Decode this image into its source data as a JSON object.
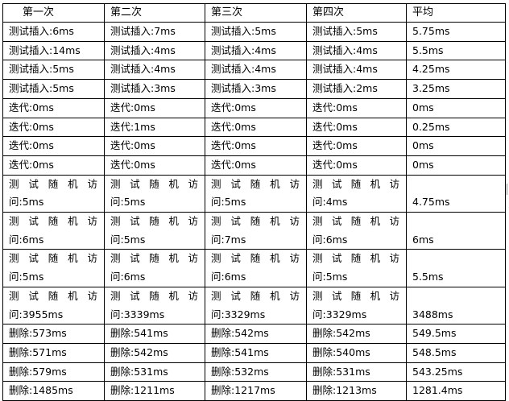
{
  "headers": [
    "第一次",
    "第二次",
    "第三次",
    "第四次",
    "平均"
  ],
  "rows": [
    {
      "cells": [
        "测试插入:6ms",
        "测试插入:7ms",
        "测试插入:5ms",
        "测试插入:5ms"
      ],
      "avg": "5.75ms"
    },
    {
      "cells": [
        "测试插入:14ms",
        "测试插入:4ms",
        "测试插入:4ms",
        "测试插入:4ms"
      ],
      "avg": "5.5ms"
    },
    {
      "cells": [
        "测试插入:5ms",
        "测试插入:4ms",
        "测试插入:4ms",
        "测试插入:4ms"
      ],
      "avg": "4.25ms"
    },
    {
      "cells": [
        "测试插入:5ms",
        "测试插入:3ms",
        "测试插入:3ms",
        "测试插入:2ms"
      ],
      "avg": "3.25ms"
    },
    {
      "cells": [
        "迭代:0ms",
        "迭代:0ms",
        "迭代:0ms",
        "迭代:0ms"
      ],
      "avg": "0ms"
    },
    {
      "cells": [
        "迭代:0ms",
        "迭代:1ms",
        "迭代:0ms",
        "迭代:0ms"
      ],
      "avg": "0.25ms"
    },
    {
      "cells": [
        "迭代:0ms",
        "迭代:0ms",
        "迭代:0ms",
        "迭代:0ms"
      ],
      "avg": "0ms"
    },
    {
      "cells": [
        "迭代:0ms",
        "迭代:0ms",
        "迭代:0ms",
        "迭代:0ms"
      ],
      "avg": "0ms"
    }
  ],
  "wrap_prefix": "测试随机访",
  "wrap_rows": [
    {
      "cells": [
        "问:5ms",
        "问:5ms",
        "问:5ms",
        "问:4ms"
      ],
      "avg": "4.75ms"
    },
    {
      "cells": [
        "问:6ms",
        "问:5ms",
        "问:7ms",
        "问:6ms"
      ],
      "avg": "6ms"
    },
    {
      "cells": [
        "问:5ms",
        "问:6ms",
        "问:6ms",
        "问:5ms"
      ],
      "avg": "5.5ms"
    },
    {
      "cells": [
        "问:3955ms",
        "问:3339ms",
        "问:3329ms",
        "问:3329ms"
      ],
      "avg": "3488ms"
    }
  ],
  "delete_rows": [
    {
      "cells": [
        "删除:573ms",
        "删除:541ms",
        "删除:542ms",
        "删除:542ms"
      ],
      "avg": "549.5ms"
    },
    {
      "cells": [
        "删除:571ms",
        "删除:542ms",
        "删除:541ms",
        "删除:540ms"
      ],
      "avg": "548.5ms"
    },
    {
      "cells": [
        "删除:579ms",
        "删除:531ms",
        "删除:532ms",
        "删除:531ms"
      ],
      "avg": "543.25ms"
    },
    {
      "cells": [
        "删除:1485ms",
        "删除:1211ms",
        "删除:1217ms",
        "删除:1213ms"
      ],
      "avg": "1281.4ms"
    }
  ]
}
